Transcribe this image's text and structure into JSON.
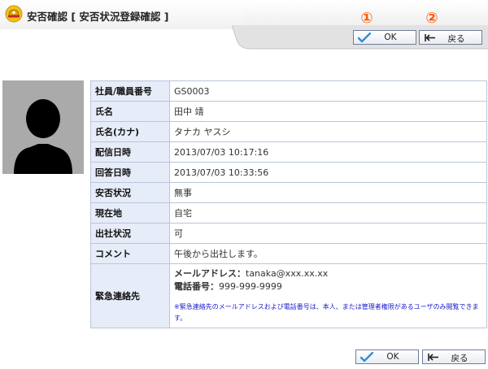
{
  "header": {
    "title": "安否確認 [ 安否状況登録確認 ]",
    "marker_1": "①",
    "marker_2": "②"
  },
  "buttons": {
    "ok_label": "OK",
    "back_label": "戻る"
  },
  "details": {
    "rows": [
      {
        "label": "社員/職員番号",
        "value": "GS0003"
      },
      {
        "label": "氏名",
        "value": "田中 靖"
      },
      {
        "label": "氏名(カナ)",
        "value": "タナカ ヤスシ"
      },
      {
        "label": "配信日時",
        "value": "2013/07/03 10:17:16"
      },
      {
        "label": "回答日時",
        "value": "2013/07/03 10:33:56"
      },
      {
        "label": "安否状況",
        "value": "無事"
      },
      {
        "label": "現在地",
        "value": "自宅"
      },
      {
        "label": "出社状況",
        "value": "可"
      },
      {
        "label": "コメント",
        "value": "午後から出社します。"
      }
    ],
    "emergency": {
      "label": "緊急連絡先",
      "email_label": "メールアドレス：",
      "email_value": "tanaka@xxx.xx.xx",
      "phone_label": "電話番号：",
      "phone_value": "999-999-9999",
      "note": "※緊急連絡先のメールアドレスおよび電話番号は、本人、または管理者権限があるユーザのみ閲覧できます。"
    }
  },
  "colors": {
    "header_label_bg": "#e6ecf8",
    "table_border": "#b9c6dc",
    "marker": "#ff5500",
    "note_text": "#1a1acc"
  },
  "icons": {
    "logo": "helmet-logo-icon",
    "ok": "checkmark-icon",
    "back": "return-arrow-icon"
  }
}
